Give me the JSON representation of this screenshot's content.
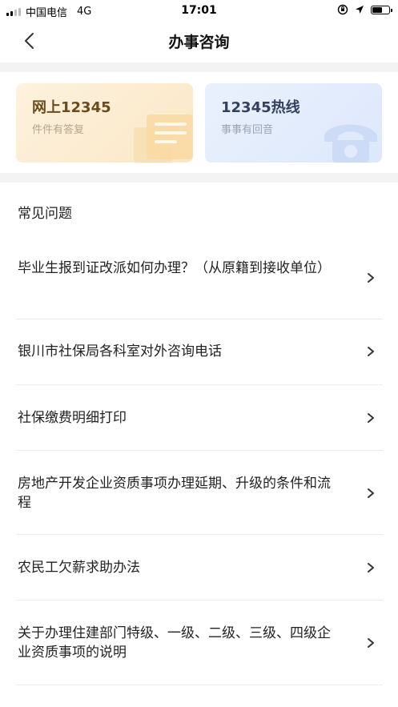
{
  "status_bar": {
    "carrier": "中国电信",
    "network": "4G",
    "time": "17:01"
  },
  "nav": {
    "title": "办事咨询"
  },
  "cards": [
    {
      "title": "网上12345",
      "subtitle": "件件有答复",
      "icon": "document-icon"
    },
    {
      "title": "12345热线",
      "subtitle": "事事有回音",
      "icon": "phone-icon"
    }
  ],
  "faq": {
    "section_title": "常见问题",
    "items": [
      {
        "label": "毕业生报到证改派如何办理？（从原籍到接收单位）"
      },
      {
        "label": "银川市社保局各科室对外咨询电话"
      },
      {
        "label": "社保缴费明细打印"
      },
      {
        "label": "房地产开发企业资质事项办理延期、升级的条件和流程"
      },
      {
        "label": "农民工欠薪求助办法"
      },
      {
        "label": "关于办理住建部门特级、一级、二级、三级、四级企业资质事项的说明"
      }
    ]
  },
  "colors": {
    "online_card_bg": "#fbe7c6",
    "hotline_card_bg": "#dde8fb",
    "separator": "#f3f3f3"
  }
}
